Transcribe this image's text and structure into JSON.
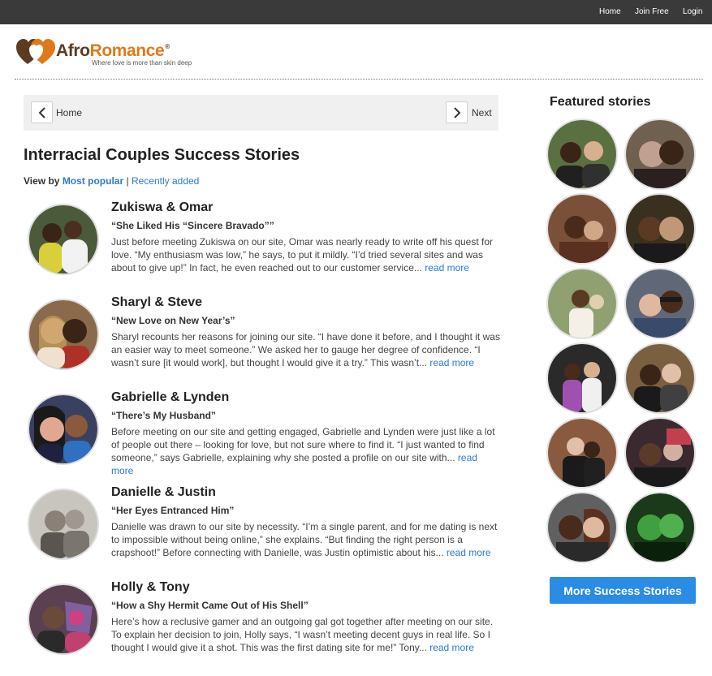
{
  "topnav": {
    "home": "Home",
    "join": "Join Free",
    "login": "Login"
  },
  "logo": {
    "afro": "Afro",
    "romance": "Romance",
    "registered": "®",
    "tagline": "Where love is more than skin deep"
  },
  "pager": {
    "prev_label": "Home",
    "next_label": "Next"
  },
  "page_title": "Interracial Couples Success Stories",
  "viewby": {
    "label": "View by",
    "most_popular": "Most popular",
    "separator": "|",
    "recently_added": "Recently added"
  },
  "stories": [
    {
      "name": "Zukiswa & Omar",
      "quote": "“She Liked His “Sincere Bravado””",
      "excerpt": "Just before meeting Zukiswa on our site, Omar was nearly ready to write off his quest for love. “My enthusiasm was low,” he says, to put it mildly. “I’d tried several sites and was about to give up!” In fact, he even reached out to our customer service...",
      "read_more": "read more"
    },
    {
      "name": "Sharyl & Steve",
      "quote": "“New Love on New Year’s”",
      "excerpt": "Sharyl recounts her reasons for joining our site. “I have done it before, and I thought it was an easier way to meet someone.” We asked her to gauge her degree of confidence. “I wasn’t sure [it would work], but thought I would give it a try.” This wasn’t...",
      "read_more": "read more"
    },
    {
      "name": "Gabrielle & Lynden",
      "quote": "“There’s My Husband”",
      "excerpt": "Before meeting on our site and getting engaged, Gabrielle and Lynden were just like a lot of people out there – looking for love, but not sure where to find it. “I just wanted to find someone,” says Gabrielle, explaining why she posted a profile on our site with...",
      "read_more": "read more"
    },
    {
      "name": "Danielle & Justin",
      "quote": "“Her Eyes Entranced Him”",
      "excerpt": "Danielle was drawn to our site by necessity. “I’m a single parent, and for me dating is next to impossible without being online,” she explains. “But finding the right person is a crapshoot!” Before connecting with Danielle, was Justin optimistic about his...",
      "read_more": "read more"
    },
    {
      "name": "Holly & Tony",
      "quote": "“How a Shy Hermit Came Out of His Shell”",
      "excerpt": "Here’s how a reclusive gamer and an outgoing gal got together after meeting on our site. To explain her decision to join, Holly says, “I wasn’t meeting decent guys in real life. So I thought I would give it a shot. This was the first dating site for me!” Tony...",
      "read_more": "read more"
    }
  ],
  "featured": {
    "title": "Featured stories",
    "button": "More Success Stories"
  }
}
